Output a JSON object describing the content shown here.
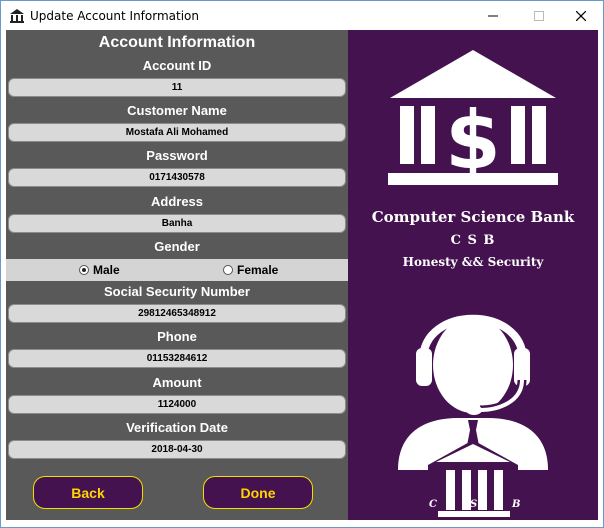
{
  "window": {
    "title": "Update Account Information"
  },
  "form": {
    "heading": "Account Information",
    "fields": [
      {
        "label": "Account ID",
        "value": "11"
      },
      {
        "label": "Customer Name",
        "value": "Mostafa Ali Mohamed"
      },
      {
        "label": "Password",
        "value": "0171430578"
      },
      {
        "label": "Address",
        "value": "Banha"
      }
    ],
    "gender": {
      "label": "Gender",
      "options": [
        "Male",
        "Female"
      ],
      "selected": "Male"
    },
    "fields2": [
      {
        "label": "Social Security Number",
        "value": "29812465348912"
      },
      {
        "label": "Phone",
        "value": "01153284612"
      },
      {
        "label": "Amount",
        "value": "1124000"
      },
      {
        "label": "Verification Date",
        "value": "2018-04-30"
      }
    ],
    "buttons": {
      "back": "Back",
      "done": "Done"
    }
  },
  "brand": {
    "name": "Computer Science Bank",
    "abbr": "C S B",
    "tagline": "Honesty && Security",
    "emblem_letters": [
      "C",
      "S",
      "B"
    ],
    "colors": {
      "panel": "#44124f",
      "accent": "#ffd400"
    },
    "icons": [
      "bank-dollar-logo",
      "support-agent-icon"
    ]
  }
}
